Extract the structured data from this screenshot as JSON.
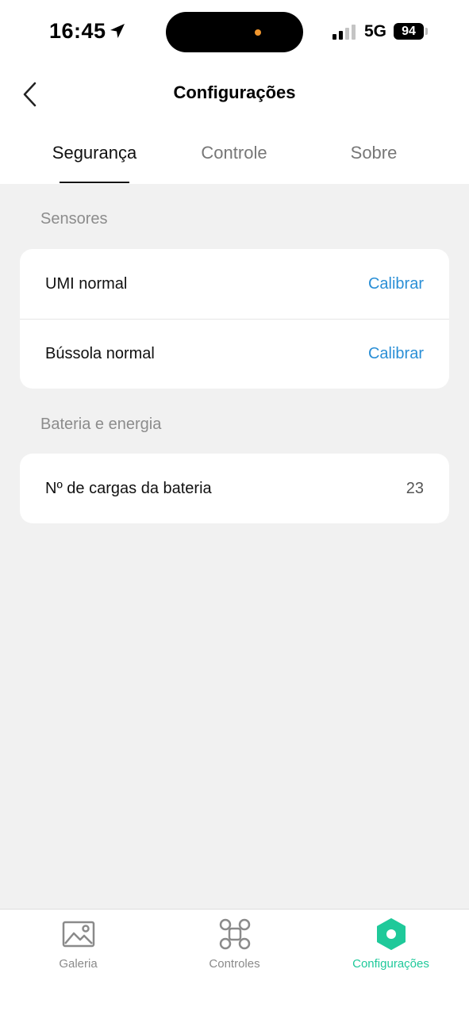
{
  "status_bar": {
    "time": "16:45",
    "network": "5G",
    "battery": "94"
  },
  "header": {
    "title": "Configurações"
  },
  "tabs": [
    {
      "label": "Segurança",
      "active": true
    },
    {
      "label": "Controle",
      "active": false
    },
    {
      "label": "Sobre",
      "active": false
    }
  ],
  "sections": {
    "sensors": {
      "title": "Sensores",
      "rows": [
        {
          "label": "UMI normal",
          "action": "Calibrar"
        },
        {
          "label": "Bússola normal",
          "action": "Calibrar"
        }
      ]
    },
    "battery": {
      "title": "Bateria e energia",
      "rows": [
        {
          "label": "Nº de cargas da bateria",
          "value": "23"
        }
      ]
    }
  },
  "bottom_nav": [
    {
      "label": "Galeria",
      "icon": "gallery-icon",
      "active": false
    },
    {
      "label": "Controles",
      "icon": "drone-icon",
      "active": false
    },
    {
      "label": "Configurações",
      "icon": "settings-hex-icon",
      "active": true
    }
  ],
  "colors": {
    "accent_link": "#2a8fd6",
    "active_nav": "#1fc99a",
    "background": "#f1f1f1"
  }
}
